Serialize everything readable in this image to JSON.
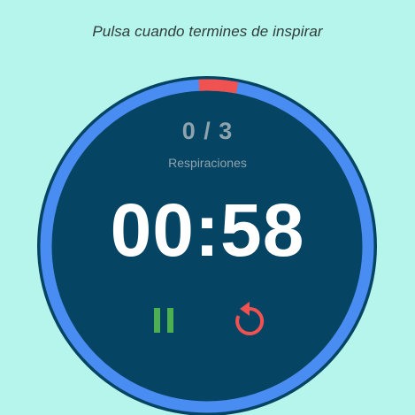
{
  "instruction": "Pulsa cuando termines de inspirar",
  "breath_counter": {
    "current": 0,
    "total": 3,
    "display": "0 / 3",
    "label": "Respiraciones"
  },
  "timer": {
    "display": "00:58"
  },
  "progress": {
    "elapsed_fraction": 0.03
  },
  "controls": {
    "pause_icon": "pause-icon",
    "reset_icon": "reset-icon"
  },
  "colors": {
    "background": "#b6f5ec",
    "dial": "#064463",
    "ring": "#4a8df2",
    "ring_marker": "#f05252",
    "pause": "#4caf50",
    "reset": "#f05252",
    "timer_text": "#ffffff",
    "muted_text": "#8fa3ad"
  }
}
